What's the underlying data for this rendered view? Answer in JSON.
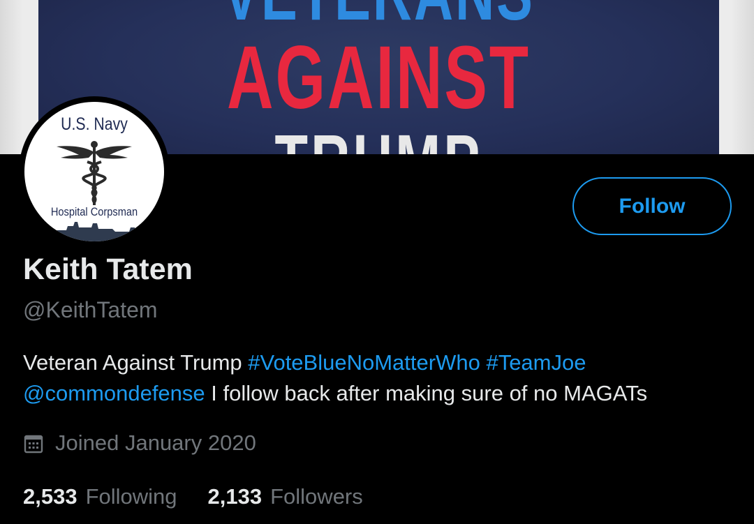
{
  "banner": {
    "line1": "VETERANS",
    "line2": "AGAINST",
    "line3": "TRUMP",
    "colors": {
      "navy": "#25305a",
      "blue": "#2e8be0",
      "red": "#e8283f"
    }
  },
  "avatar": {
    "top_text": "U.S. Navy",
    "bottom_text": "Hospital Corpsman",
    "emblem": "caduceus-icon"
  },
  "actions": {
    "follow_label": "Follow"
  },
  "profile": {
    "name": "Keith Tatem",
    "handle": "@KeithTatem",
    "bio": {
      "text1": "Veteran Against Trump ",
      "hashtag1": "#VoteBlueNoMatterWho",
      "hashtag2": "#TeamJoe",
      "mention": "@commondefense",
      "text2": " I follow back after making sure of no MAGATs"
    },
    "joined": "Joined January 2020",
    "joined_icon": "calendar-icon"
  },
  "stats": {
    "following_count": "2,533",
    "following_label": "Following",
    "followers_count": "2,133",
    "followers_label": "Followers"
  },
  "colors": {
    "background": "#000000",
    "accent": "#1d9bf0",
    "primary_text": "#e7e9ea",
    "secondary_text": "#71767b"
  }
}
